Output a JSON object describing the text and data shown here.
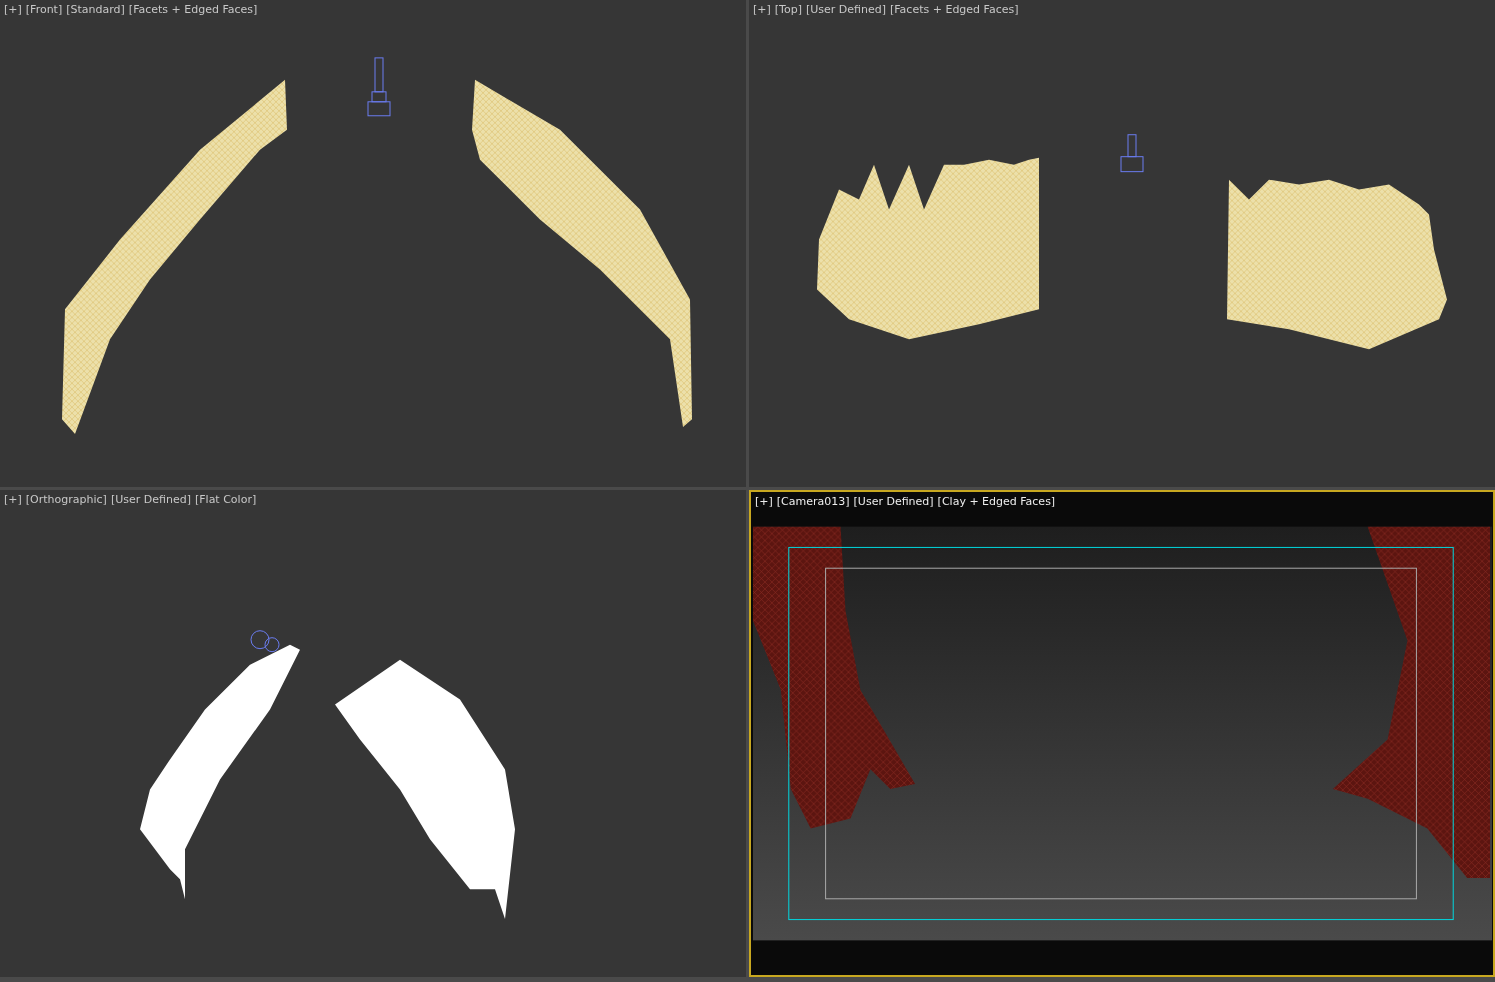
{
  "viewports": [
    {
      "kind": "front",
      "active": false,
      "labels": [
        "[+]",
        "[Front]",
        "[Standard]",
        "[Facets + Edged Faces]"
      ]
    },
    {
      "kind": "top",
      "active": false,
      "labels": [
        "[+]",
        "[Top]",
        "[User Defined]",
        "[Facets + Edged Faces]"
      ]
    },
    {
      "kind": "ortho",
      "active": false,
      "labels": [
        "[+]",
        "[Orthographic]",
        "[User Defined]",
        "[Flat Color]"
      ]
    },
    {
      "kind": "camera",
      "active": true,
      "labels": [
        "[+]",
        "[Camera013]",
        "[User Defined]",
        "[Clay + Edged Faces]"
      ]
    }
  ]
}
